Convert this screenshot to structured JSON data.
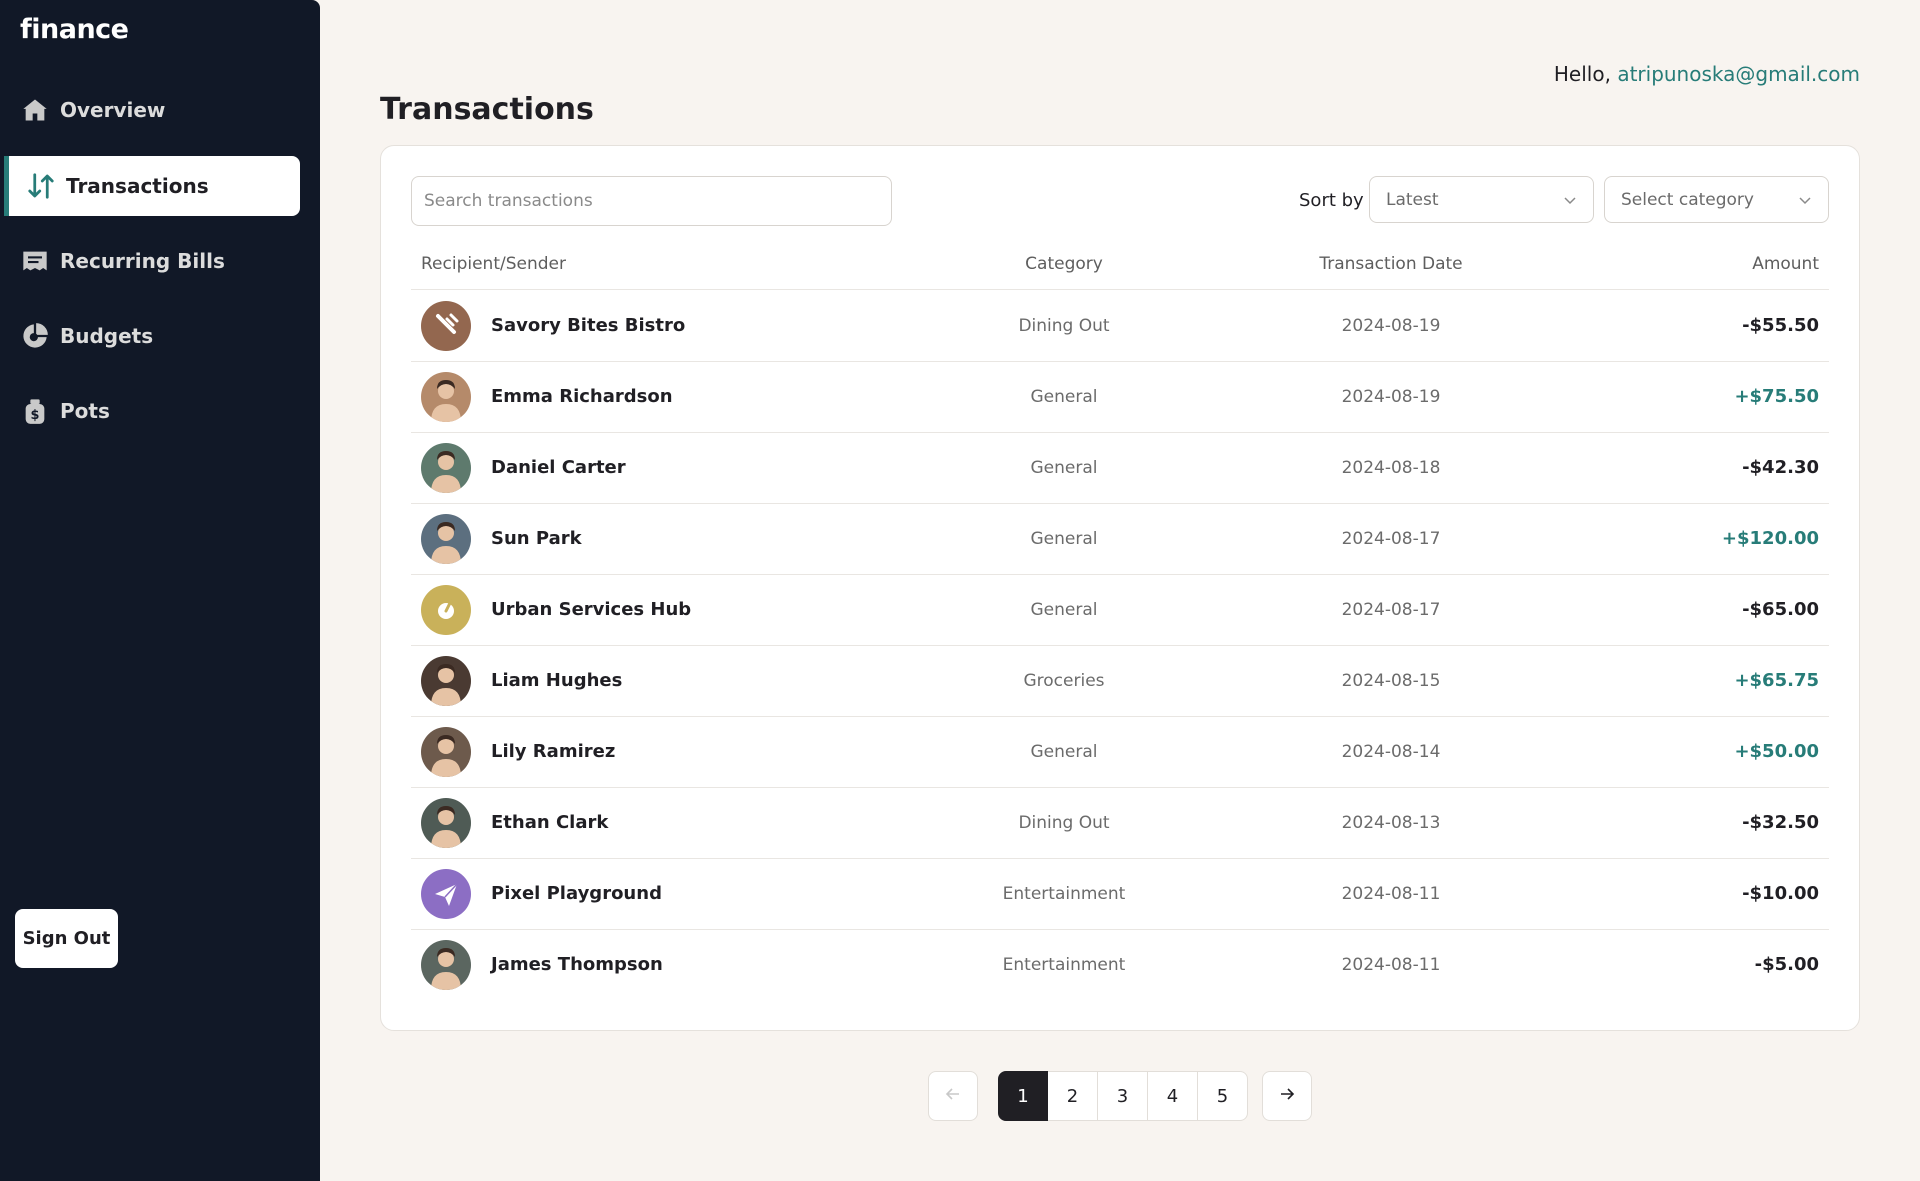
{
  "app": {
    "logo": "finance"
  },
  "sidebar": {
    "items": [
      {
        "label": "Overview",
        "icon": "home-icon"
      },
      {
        "label": "Transactions",
        "icon": "arrows-up-down-icon",
        "active": true
      },
      {
        "label": "Recurring Bills",
        "icon": "receipt-icon"
      },
      {
        "label": "Budgets",
        "icon": "pie-chart-icon"
      },
      {
        "label": "Pots",
        "icon": "money-bag-icon"
      }
    ],
    "signout_label": "Sign Out"
  },
  "header": {
    "greeting": "Hello, ",
    "email": "atripunoska@gmail.com",
    "title": "Transactions"
  },
  "filters": {
    "search_placeholder": "Search transactions",
    "sort_label": "Sort by",
    "sort_value": "Latest",
    "category_value": "Select category"
  },
  "table": {
    "columns": [
      "Recipient/Sender",
      "Category",
      "Transaction Date",
      "Amount"
    ],
    "rows": [
      {
        "name": "Savory Bites Bistro",
        "category": "Dining Out",
        "date": "2024-08-19",
        "amount": "-$55.50",
        "positive": false,
        "avatar": "fork-icon",
        "avatar_color": "#93674f"
      },
      {
        "name": "Emma Richardson",
        "category": "General",
        "date": "2024-08-19",
        "amount": "+$75.50",
        "positive": true,
        "avatar": "person-photo",
        "avatar_color": "#b58a6a"
      },
      {
        "name": "Daniel Carter",
        "category": "General",
        "date": "2024-08-18",
        "amount": "-$42.30",
        "positive": false,
        "avatar": "person-photo",
        "avatar_color": "#5e7a6d"
      },
      {
        "name": "Sun Park",
        "category": "General",
        "date": "2024-08-17",
        "amount": "+$120.00",
        "positive": true,
        "avatar": "person-photo",
        "avatar_color": "#5c6f7f"
      },
      {
        "name": "Urban Services Hub",
        "category": "General",
        "date": "2024-08-17",
        "amount": "-$65.00",
        "positive": false,
        "avatar": "leaf-icon",
        "avatar_color": "#c9b15a"
      },
      {
        "name": "Liam Hughes",
        "category": "Groceries",
        "date": "2024-08-15",
        "amount": "+$65.75",
        "positive": true,
        "avatar": "person-photo",
        "avatar_color": "#4a3a32"
      },
      {
        "name": "Lily Ramirez",
        "category": "General",
        "date": "2024-08-14",
        "amount": "+$50.00",
        "positive": true,
        "avatar": "person-photo",
        "avatar_color": "#6d5a4c"
      },
      {
        "name": "Ethan Clark",
        "category": "Dining Out",
        "date": "2024-08-13",
        "amount": "-$32.50",
        "positive": false,
        "avatar": "person-photo",
        "avatar_color": "#4f5b55"
      },
      {
        "name": "Pixel Playground",
        "category": "Entertainment",
        "date": "2024-08-11",
        "amount": "-$10.00",
        "positive": false,
        "avatar": "paper-plane-icon",
        "avatar_color": "#8c6ec4"
      },
      {
        "name": "James Thompson",
        "category": "Entertainment",
        "date": "2024-08-11",
        "amount": "-$5.00",
        "positive": false,
        "avatar": "person-photo",
        "avatar_color": "#5b6660"
      }
    ]
  },
  "pagination": {
    "pages": [
      "1",
      "2",
      "3",
      "4",
      "5"
    ],
    "current": "1",
    "prev_icon": "arrow-left-icon",
    "next_icon": "arrow-right-icon"
  },
  "colors": {
    "sidebar_bg": "#111827",
    "accent": "#277c78",
    "page_bg": "#f8f4f0"
  }
}
